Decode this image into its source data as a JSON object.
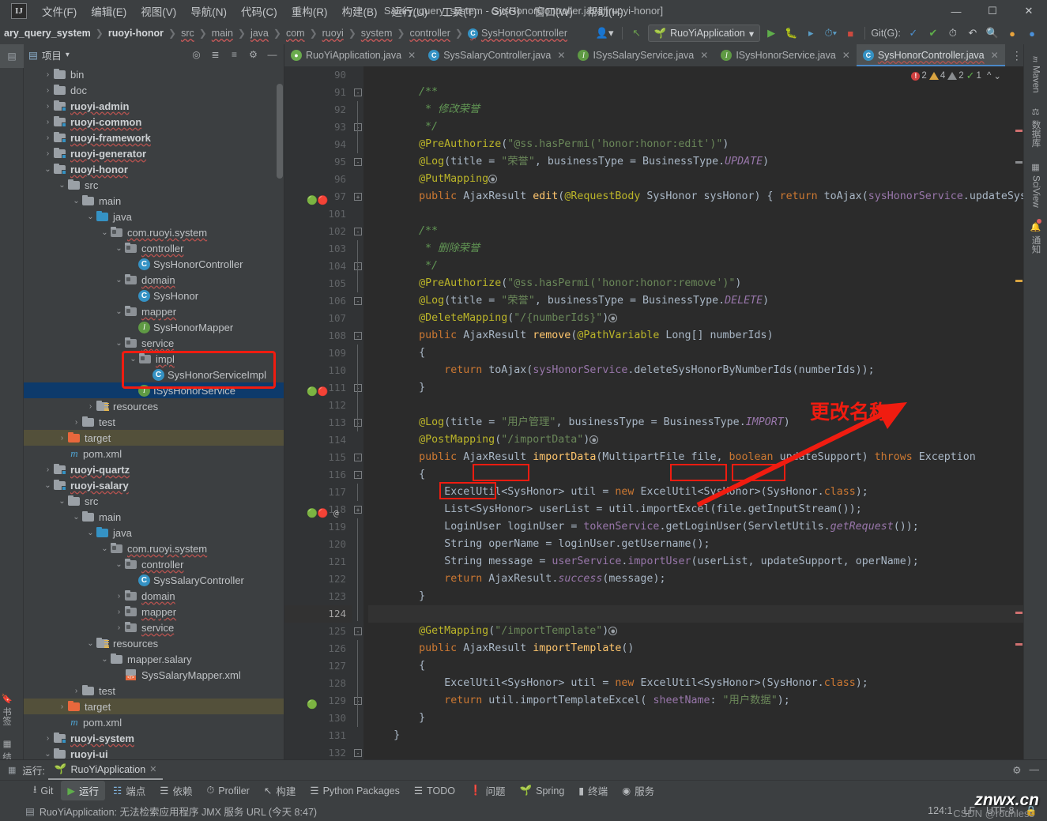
{
  "window": {
    "title": "Salary_query_system - SysHonorController.java [ruoyi-honor]",
    "logo": "IJ",
    "minimize": "—",
    "maximize": "☐",
    "close": "✕"
  },
  "menu": [
    {
      "label": "文件(F)"
    },
    {
      "label": "编辑(E)"
    },
    {
      "label": "视图(V)"
    },
    {
      "label": "导航(N)"
    },
    {
      "label": "代码(C)"
    },
    {
      "label": "重构(R)"
    },
    {
      "label": "构建(B)"
    },
    {
      "label": "运行(U)"
    },
    {
      "label": "工具(T)"
    },
    {
      "label": "Git(G)"
    },
    {
      "label": "窗口(W)"
    },
    {
      "label": "帮助(H)"
    }
  ],
  "breadcrumb": [
    {
      "label": "ary_query_system",
      "bold": true
    },
    {
      "label": "ruoyi-honor",
      "bold": true
    },
    {
      "label": "src"
    },
    {
      "label": "main"
    },
    {
      "label": "java"
    },
    {
      "label": "com"
    },
    {
      "label": "ruoyi"
    },
    {
      "label": "system"
    },
    {
      "label": "controller"
    },
    {
      "label": "SysHonorController",
      "icon": "C"
    }
  ],
  "toolbar": {
    "run_config": "RuoYiApplication",
    "git_label": "Git(G):",
    "avatar_icon": "user-icon",
    "back_icon": "back-arrow-icon",
    "run_icon": "run-icon",
    "debug_icon": "debug-icon",
    "coverage_icon": "coverage-icon",
    "profile_icon": "profile-icon",
    "stop_icon": "stop-icon",
    "update_icon": "update-project-icon",
    "commit_icon": "commit-icon",
    "history_icon": "history-icon",
    "rollback_icon": "rollback-icon",
    "search_icon": "search-icon",
    "notify_icon": "notification-icon",
    "ide_icon": "ide-icon"
  },
  "left_strip": {
    "project_label": "项目",
    "bookmarks_label": "书签",
    "structure_label": "结构"
  },
  "project_panel": {
    "title": "项目",
    "actions": [
      "locate-icon",
      "expand-all-icon",
      "collapse-all-icon",
      "settings-icon",
      "minimize-icon"
    ],
    "tree": [
      {
        "indent": 1,
        "arrow": "›",
        "type": "folder",
        "label": "bin"
      },
      {
        "indent": 1,
        "arrow": "›",
        "type": "folder",
        "label": "doc"
      },
      {
        "indent": 1,
        "arrow": "›",
        "type": "module",
        "label": "ruoyi-admin",
        "bold": true
      },
      {
        "indent": 1,
        "arrow": "›",
        "type": "module",
        "label": "ruoyi-common",
        "bold": true
      },
      {
        "indent": 1,
        "arrow": "›",
        "type": "module",
        "label": "ruoyi-framework",
        "bold": true
      },
      {
        "indent": 1,
        "arrow": "›",
        "type": "module",
        "label": "ruoyi-generator",
        "bold": true
      },
      {
        "indent": 1,
        "arrow": "⌄",
        "type": "module",
        "label": "ruoyi-honor",
        "bold": true
      },
      {
        "indent": 2,
        "arrow": "⌄",
        "type": "folder",
        "label": "src"
      },
      {
        "indent": 3,
        "arrow": "⌄",
        "type": "folder",
        "label": "main"
      },
      {
        "indent": 4,
        "arrow": "⌄",
        "type": "folder-blue",
        "label": "java"
      },
      {
        "indent": 5,
        "arrow": "⌄",
        "type": "package",
        "label": "com.ruoyi.system"
      },
      {
        "indent": 6,
        "arrow": "⌄",
        "type": "package",
        "label": "controller"
      },
      {
        "indent": 7,
        "arrow": "",
        "type": "class",
        "label": "SysHonorController"
      },
      {
        "indent": 6,
        "arrow": "⌄",
        "type": "package",
        "label": "domain"
      },
      {
        "indent": 7,
        "arrow": "",
        "type": "class",
        "label": "SysHonor"
      },
      {
        "indent": 6,
        "arrow": "⌄",
        "type": "package",
        "label": "mapper"
      },
      {
        "indent": 7,
        "arrow": "",
        "type": "interface",
        "label": "SysHonorMapper"
      },
      {
        "indent": 6,
        "arrow": "⌄",
        "type": "package",
        "label": "service"
      },
      {
        "indent": 7,
        "arrow": "⌄",
        "type": "package",
        "label": "impl"
      },
      {
        "indent": 8,
        "arrow": "",
        "type": "class",
        "label": "SysHonorServiceImpl"
      },
      {
        "indent": 7,
        "arrow": "",
        "type": "interface",
        "label": "ISysHonorService",
        "selected": true
      },
      {
        "indent": 4,
        "arrow": "›",
        "type": "resources",
        "label": "resources"
      },
      {
        "indent": 3,
        "arrow": "›",
        "type": "folder",
        "label": "test"
      },
      {
        "indent": 2,
        "arrow": "›",
        "type": "folder-orange",
        "label": "target",
        "highlight": true
      },
      {
        "indent": 2,
        "arrow": "",
        "type": "maven",
        "label": "pom.xml"
      },
      {
        "indent": 1,
        "arrow": "›",
        "type": "module",
        "label": "ruoyi-quartz",
        "bold": true
      },
      {
        "indent": 1,
        "arrow": "⌄",
        "type": "module",
        "label": "ruoyi-salary",
        "bold": true
      },
      {
        "indent": 2,
        "arrow": "⌄",
        "type": "folder",
        "label": "src"
      },
      {
        "indent": 3,
        "arrow": "⌄",
        "type": "folder",
        "label": "main"
      },
      {
        "indent": 4,
        "arrow": "⌄",
        "type": "folder-blue",
        "label": "java"
      },
      {
        "indent": 5,
        "arrow": "⌄",
        "type": "package",
        "label": "com.ruoyi.system"
      },
      {
        "indent": 6,
        "arrow": "⌄",
        "type": "package",
        "label": "controller"
      },
      {
        "indent": 7,
        "arrow": "",
        "type": "class",
        "label": "SysSalaryController"
      },
      {
        "indent": 6,
        "arrow": "›",
        "type": "package",
        "label": "domain"
      },
      {
        "indent": 6,
        "arrow": "›",
        "type": "package",
        "label": "mapper"
      },
      {
        "indent": 6,
        "arrow": "›",
        "type": "package",
        "label": "service"
      },
      {
        "indent": 4,
        "arrow": "⌄",
        "type": "resources",
        "label": "resources"
      },
      {
        "indent": 5,
        "arrow": "⌄",
        "type": "folder",
        "label": "mapper.salary"
      },
      {
        "indent": 6,
        "arrow": "",
        "type": "xml",
        "label": "SysSalaryMapper.xml"
      },
      {
        "indent": 3,
        "arrow": "›",
        "type": "folder",
        "label": "test"
      },
      {
        "indent": 2,
        "arrow": "›",
        "type": "folder-orange",
        "label": "target",
        "highlight": true
      },
      {
        "indent": 2,
        "arrow": "",
        "type": "maven",
        "label": "pom.xml"
      },
      {
        "indent": 1,
        "arrow": "›",
        "type": "module",
        "label": "ruoyi-system",
        "bold": true
      },
      {
        "indent": 1,
        "arrow": "⌄",
        "type": "folder",
        "label": "ruoyi-ui",
        "bold": true
      }
    ]
  },
  "editor_tabs": [
    {
      "label": "RuoYiApplication.java",
      "icon": "spring",
      "active": false
    },
    {
      "label": "SysSalaryController.java",
      "icon": "c",
      "active": false
    },
    {
      "label": "ISysSalaryService.java",
      "icon": "i",
      "active": false
    },
    {
      "label": "ISysHonorService.java",
      "icon": "i",
      "active": false
    },
    {
      "label": "SysHonorController.java",
      "icon": "c",
      "active": true
    }
  ],
  "inspection": {
    "errors": "2",
    "warnings": "4",
    "weak_warnings": "2",
    "checks": "1",
    "up_icon": "chevron-up-icon",
    "down_icon": "chevron-down-icon"
  },
  "code": {
    "first_line": 90,
    "current_line": 124,
    "lines": [
      {
        "n": "90",
        "code": ""
      },
      {
        "n": "91",
        "code": "        /**"
      },
      {
        "n": "92",
        "code": "         * 修改荣誉"
      },
      {
        "n": "93",
        "code": "         */"
      },
      {
        "n": "94",
        "code": "        @PreAuthorize(\"@ss.hasPermi('honor:honor:edit')\")"
      },
      {
        "n": "95",
        "code": "        @Log(title = \"荣誉\", businessType = BusinessType.UPDATE)"
      },
      {
        "n": "96",
        "code": "        @PutMapping"
      },
      {
        "n": "97",
        "code": "        public AjaxResult edit(@RequestBody SysHonor sysHonor) { return toAjax(sysHonorService.updateSysHonor"
      },
      {
        "n": "101",
        "code": ""
      },
      {
        "n": "102",
        "code": "        /**"
      },
      {
        "n": "103",
        "code": "         * 删除荣誉"
      },
      {
        "n": "104",
        "code": "         */"
      },
      {
        "n": "105",
        "code": "        @PreAuthorize(\"@ss.hasPermi('honor:honor:remove')\")"
      },
      {
        "n": "106",
        "code": "        @Log(title = \"荣誉\", businessType = BusinessType.DELETE)"
      },
      {
        "n": "107",
        "code": "        @DeleteMapping(\"/{numberIds}\")"
      },
      {
        "n": "108",
        "code": "        public AjaxResult remove(@PathVariable Long[] numberIds)"
      },
      {
        "n": "109",
        "code": "        {"
      },
      {
        "n": "110",
        "code": "            return toAjax(sysHonorService.deleteSysHonorByNumberIds(numberIds));"
      },
      {
        "n": "111",
        "code": "        }"
      },
      {
        "n": "112",
        "code": ""
      },
      {
        "n": "113",
        "code": "        @Log(title = \"用户管理\", businessType = BusinessType.IMPORT)"
      },
      {
        "n": "114",
        "code": "        @PostMapping(\"/importData\")"
      },
      {
        "n": "115",
        "code": "        public AjaxResult importData(MultipartFile file, boolean updateSupport) throws Exception"
      },
      {
        "n": "116",
        "code": "        {"
      },
      {
        "n": "117",
        "code": "            ExcelUtil<SysHonor> util = new ExcelUtil<SysHonor>(SysHonor.class);"
      },
      {
        "n": "118",
        "code": "            List<SysHonor> userList = util.importExcel(file.getInputStream());"
      },
      {
        "n": "119",
        "code": "            LoginUser loginUser = tokenService.getLoginUser(ServletUtils.getRequest());"
      },
      {
        "n": "120",
        "code": "            String operName = loginUser.getUsername();"
      },
      {
        "n": "121",
        "code": "            String message = userService.importUser(userList, updateSupport, operName);"
      },
      {
        "n": "122",
        "code": "            return AjaxResult.success(message);"
      },
      {
        "n": "123",
        "code": "        }"
      },
      {
        "n": "124",
        "code": ""
      },
      {
        "n": "125",
        "code": "        @GetMapping(\"/importTemplate\")"
      },
      {
        "n": "126",
        "code": "        public AjaxResult importTemplate()"
      },
      {
        "n": "127",
        "code": "        {"
      },
      {
        "n": "128",
        "code": "            ExcelUtil<SysHonor> util = new ExcelUtil<SysHonor>(SysHonor.class);"
      },
      {
        "n": "129",
        "code": "            return util.importTemplateExcel( sheetName: \"用户数据\");"
      },
      {
        "n": "130",
        "code": "        }"
      },
      {
        "n": "131",
        "code": "    }"
      },
      {
        "n": "132",
        "code": ""
      }
    ]
  },
  "annotation": {
    "note_text": "更改名称",
    "arrow_icon": "red-arrow-icon",
    "color": "#f01c10"
  },
  "right_strip": [
    {
      "label": "Maven",
      "icon": "maven-icon"
    },
    {
      "label": "数据库",
      "icon": "database-icon"
    },
    {
      "label": "SciView",
      "icon": "sciview-icon"
    },
    {
      "label": "通知",
      "icon": "bell-icon",
      "badge": true
    }
  ],
  "run_panel": {
    "label": "运行:",
    "tab": "RuoYiApplication",
    "close_icon": "close-icon",
    "settings_icon": "gear-icon",
    "minimize_icon": "minimize-icon"
  },
  "bottom_bar": [
    {
      "label": "Git",
      "icon": "git-branch-icon",
      "active": false
    },
    {
      "label": "运行",
      "icon": "run-icon",
      "active": true
    },
    {
      "label": "端点",
      "icon": "endpoints-icon",
      "active": false
    },
    {
      "label": "依赖",
      "icon": "dependencies-icon",
      "active": false
    },
    {
      "label": "Profiler",
      "icon": "profiler-icon",
      "active": false
    },
    {
      "label": "构建",
      "icon": "build-icon",
      "active": false
    },
    {
      "label": "Python Packages",
      "icon": "python-packages-icon",
      "active": false
    },
    {
      "label": "TODO",
      "icon": "todo-icon",
      "active": false
    },
    {
      "label": "问题",
      "icon": "problems-icon",
      "active": false
    },
    {
      "label": "Spring",
      "icon": "spring-icon",
      "active": false
    },
    {
      "label": "终端",
      "icon": "terminal-icon",
      "active": false
    },
    {
      "label": "服务",
      "icon": "services-icon",
      "active": false
    }
  ],
  "status_bar": {
    "message": "RuoYiApplication: 无法检索应用程序 JMX 服务 URL (今天 8:47)",
    "message_icon": "log-icon",
    "caret": "124:1",
    "line_sep": "LF",
    "encoding": "UTF-8",
    "lock_icon": "lock-icon"
  },
  "watermark": {
    "main": "znwx.cn",
    "sub": "CSDN @rounless"
  }
}
